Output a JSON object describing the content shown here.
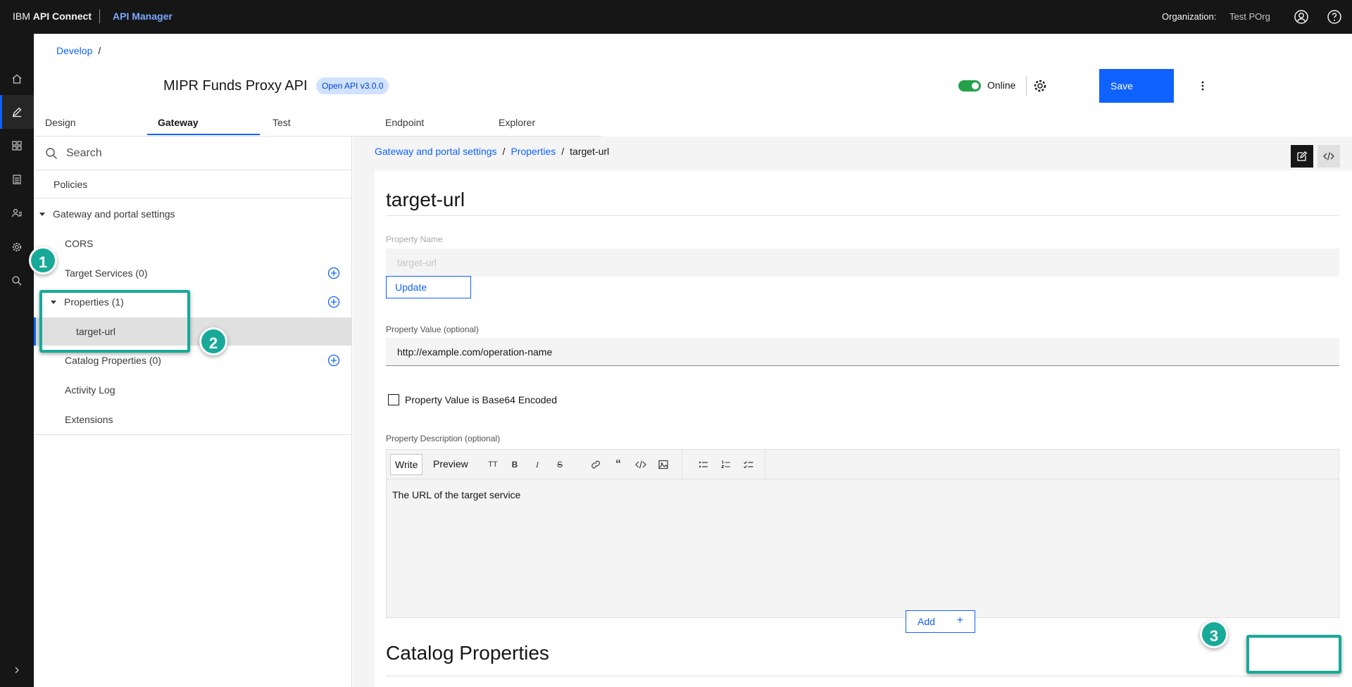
{
  "topbar": {
    "brand_light": "IBM ",
    "brand_bold": "API Connect",
    "product": "API Manager",
    "org_label": "Organization:",
    "org_value": "Test POrg"
  },
  "breadcrumb_top": {
    "link": "Develop",
    "sep": "/"
  },
  "api": {
    "title": "MIPR Funds Proxy API",
    "tag": "Open API v3.0.0",
    "status": "Online",
    "save_label": "Save"
  },
  "tabs": [
    "Design",
    "Gateway",
    "Test",
    "Endpoint",
    "Explorer"
  ],
  "sidebar": {
    "search_placeholder": "Search",
    "policies": "Policies",
    "group": "Gateway and portal settings",
    "items": {
      "cors": "CORS",
      "target_services": "Target Services (0)",
      "properties": "Properties (1)",
      "target_url": "target-url",
      "catalog_properties": "Catalog Properties (0)",
      "activity_log": "Activity Log",
      "extensions": "Extensions"
    }
  },
  "main": {
    "breadcrumb": [
      "Gateway and portal settings",
      "Properties",
      "target-url"
    ],
    "title": "target-url",
    "property_name_label": "Property Name",
    "property_name_value": "target-url",
    "update_label": "Update",
    "property_value_label": "Property Value (optional)",
    "property_value": "http://example.com/operation-name",
    "base64_label": "Property Value is Base64 Encoded",
    "description_label": "Property Description (optional)",
    "editor_write": "Write",
    "editor_preview": "Preview",
    "description_text": "The URL of the target service",
    "catalog_title": "Catalog Properties",
    "add_label": "Add",
    "add_plus": "+"
  },
  "toolbar_icons": [
    "heading-icon",
    "bold-icon",
    "italic-icon",
    "strikethrough-icon",
    "link-icon",
    "quote-icon",
    "code-icon",
    "image-icon",
    "bulleted-list-icon",
    "numbered-list-icon",
    "task-list-icon"
  ],
  "annotations": {
    "step1": "1",
    "step2": "2",
    "step3": "3"
  },
  "colors": {
    "accent": "#0f62fe",
    "highlight": "#18a999",
    "online": "#24a148"
  }
}
